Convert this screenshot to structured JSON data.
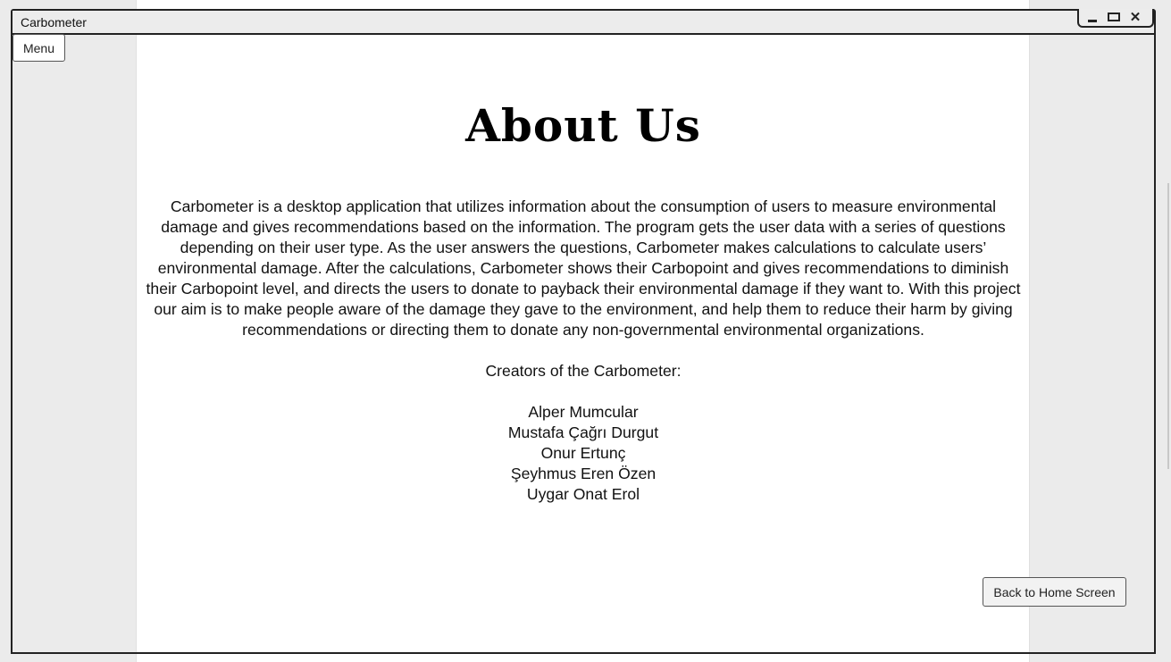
{
  "window": {
    "title": "Carbometer",
    "controls": {
      "minimize_icon": "minimize-icon",
      "maximize_icon": "maximize-icon",
      "close_icon": "close-icon",
      "close_glyph": "✕"
    }
  },
  "menu": {
    "label": "Menu"
  },
  "page": {
    "heading": "About Us",
    "description": "Carbometer is a desktop application that utilizes information about the consumption of users to measure environmental damage and gives recommendations based on the information. The program gets the user data with a series of questions depending on their user type. As the user answers the questions, Carbometer makes calculations to calculate users’ environmental damage. After the calculations, Carbometer shows their Carbopoint and gives recommendations to diminish their Carbopoint level, and directs the users to donate to payback their environmental damage if they want to. With this project our aim is to make people aware of the damage they gave to the environment, and help them to reduce their harm by giving recommendations or directing them to donate any non-governmental environmental organizations.",
    "creators_title": "Creators of the Carbometer:",
    "creators": [
      "Alper Mumcular",
      "Mustafa Çağrı Durgut",
      "Onur Ertunç",
      "Şeyhmus Eren Özen",
      "Uygar Onat Erol"
    ]
  },
  "footer": {
    "back_label": "Back to Home Screen"
  },
  "colors": {
    "page_background": "#ebebeb",
    "content_background": "#ffffff",
    "window_border": "#222222",
    "text": "#111111"
  }
}
